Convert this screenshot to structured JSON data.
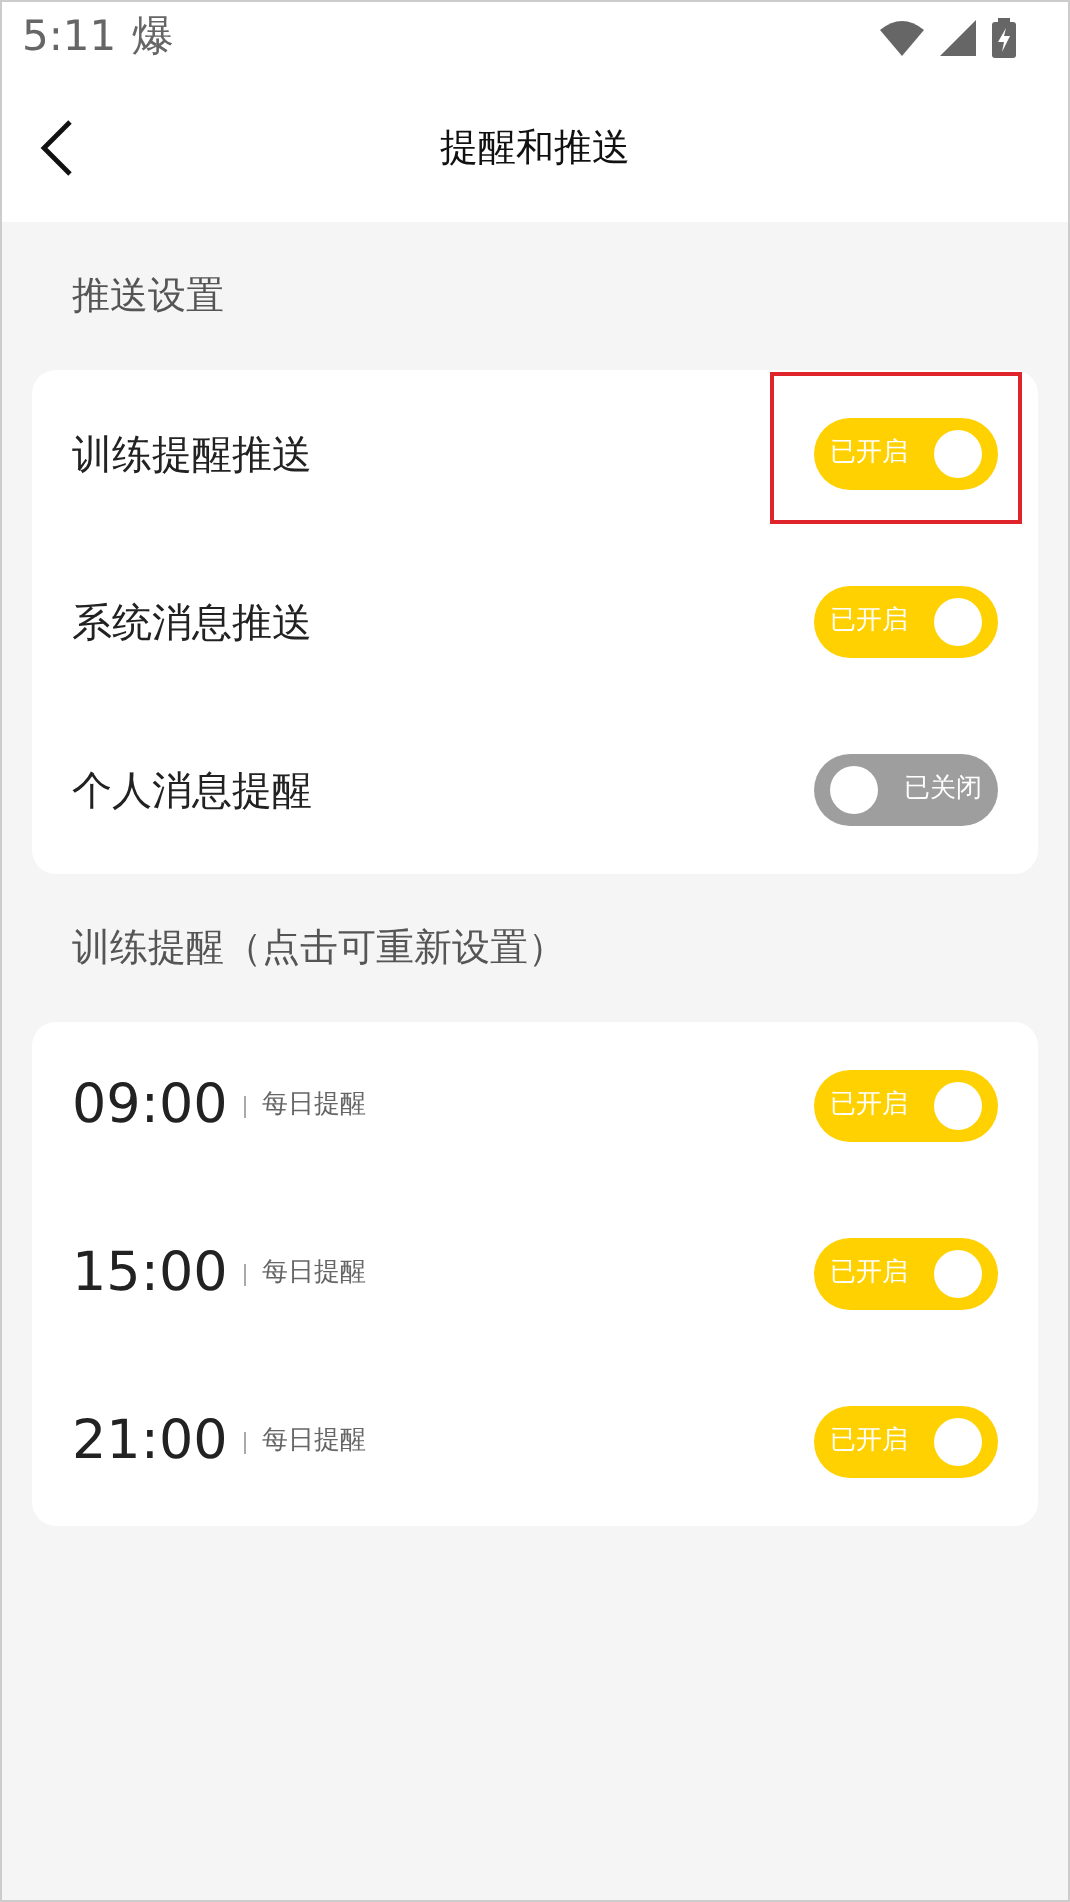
{
  "status_bar": {
    "time": "5:11",
    "notification": "爆"
  },
  "header": {
    "title": "提醒和推送"
  },
  "push_section": {
    "title": "推送设置",
    "items": [
      {
        "label": "训练提醒推送",
        "on": true,
        "toggle_text": "已开启",
        "highlighted": true
      },
      {
        "label": "系统消息推送",
        "on": true,
        "toggle_text": "已开启",
        "highlighted": false
      },
      {
        "label": "个人消息提醒",
        "on": false,
        "toggle_text": "已关闭",
        "highlighted": false
      }
    ]
  },
  "reminder_section": {
    "title": "训练提醒（点击可重新设置）",
    "items": [
      {
        "time": "09:00",
        "repeat": "每日提醒",
        "on": true,
        "toggle_text": "已开启"
      },
      {
        "time": "15:00",
        "repeat": "每日提醒",
        "on": true,
        "toggle_text": "已开启"
      },
      {
        "time": "21:00",
        "repeat": "每日提醒",
        "on": true,
        "toggle_text": "已开启"
      }
    ]
  }
}
